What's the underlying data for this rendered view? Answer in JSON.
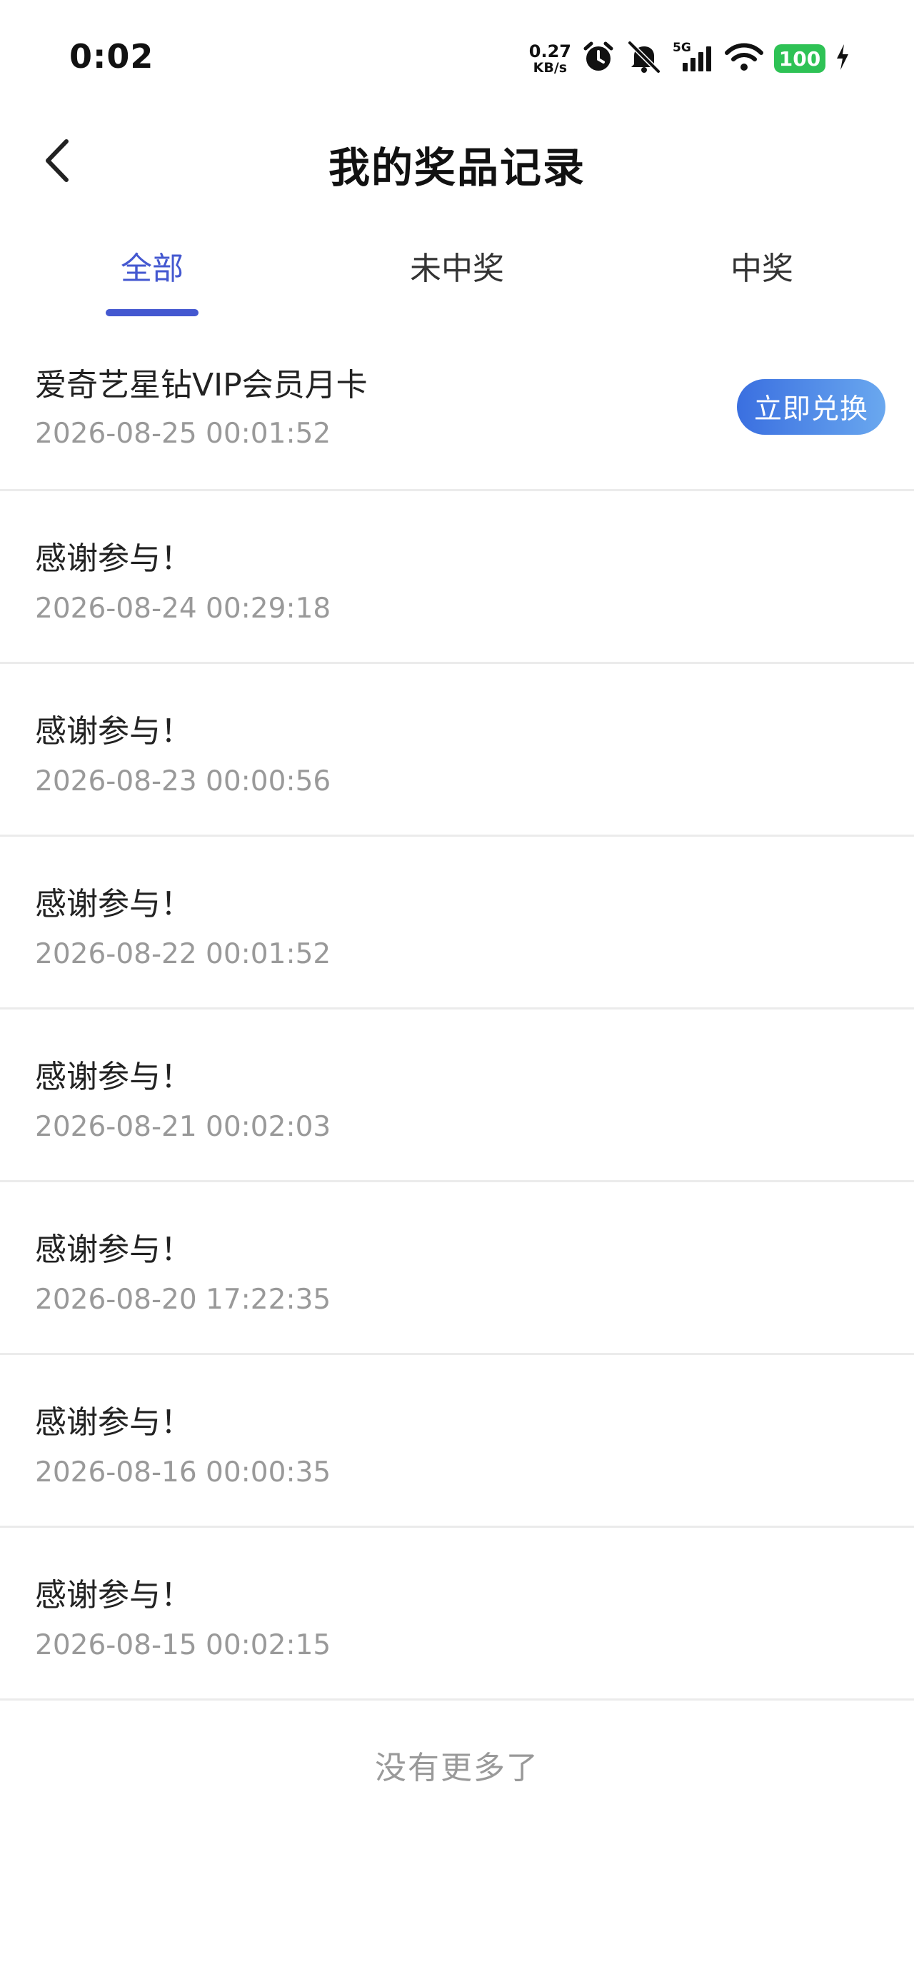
{
  "status_bar": {
    "time": "0:02",
    "net_speed_value": "0.27",
    "net_speed_unit": "KB/s",
    "network_type": "5G",
    "battery_level": "100",
    "icons": [
      "alarm-icon",
      "mute-icon",
      "signal-icon",
      "wifi-icon",
      "battery-icon",
      "charging-icon"
    ],
    "battery_color": "#2ec255"
  },
  "header": {
    "title": "我的奖品记录",
    "back_icon": "chevron-left-icon"
  },
  "tabs": {
    "items": [
      {
        "label": "全部",
        "active": true
      },
      {
        "label": "未中奖",
        "active": false
      },
      {
        "label": "中奖",
        "active": false
      }
    ],
    "active_color": "#4458d0"
  },
  "records": [
    {
      "name": "爱奇艺星钻VIP会员月卡",
      "time": "2026-08-25 00:01:52",
      "action_label": "立即兑换"
    },
    {
      "name": "感谢参与！",
      "time": "2026-08-24 00:29:18"
    },
    {
      "name": "感谢参与！",
      "time": "2026-08-23 00:00:56"
    },
    {
      "name": "感谢参与！",
      "time": "2026-08-22 00:01:52"
    },
    {
      "name": "感谢参与！",
      "time": "2026-08-21 00:02:03"
    },
    {
      "name": "感谢参与！",
      "time": "2026-08-20 17:22:35"
    },
    {
      "name": "感谢参与！",
      "time": "2026-08-16 00:00:35"
    },
    {
      "name": "感谢参与！",
      "time": "2026-08-15 00:02:15"
    }
  ],
  "footer": {
    "no_more_text": "没有更多了"
  }
}
